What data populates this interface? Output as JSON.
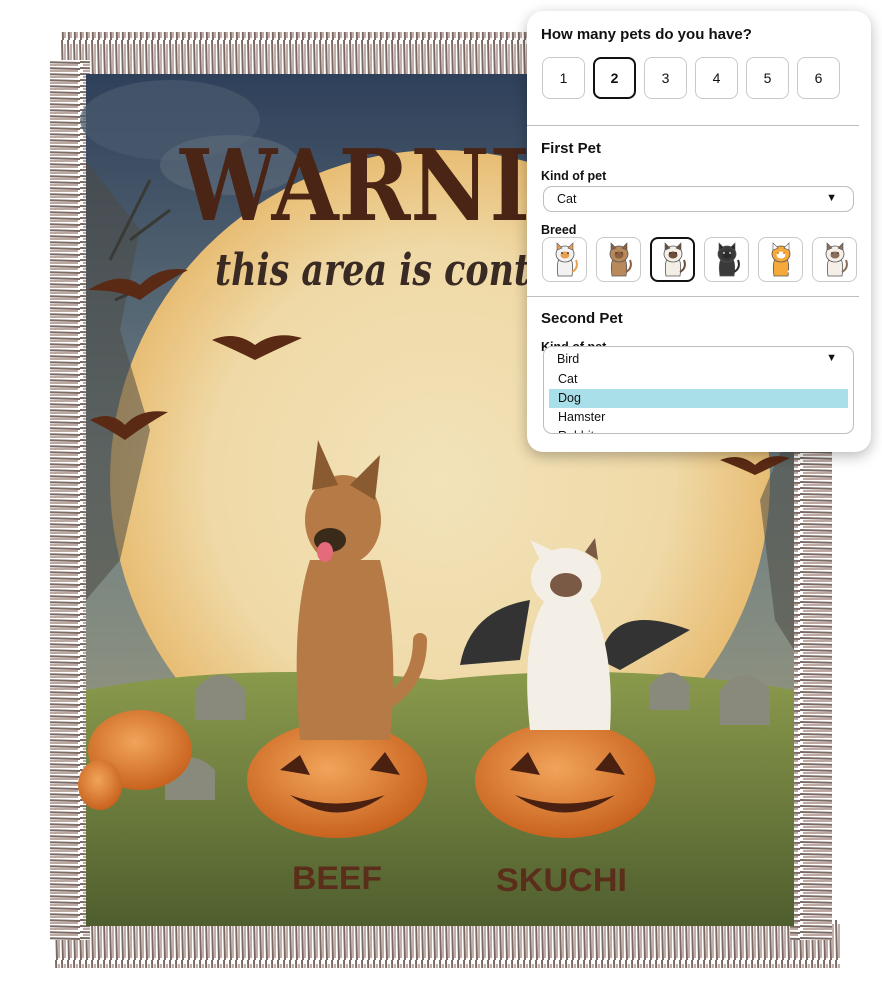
{
  "blanket": {
    "title": "WARNI",
    "subtitle": "this area is cont",
    "pets": [
      {
        "name": "BEEF"
      },
      {
        "name": "SKUCHI"
      }
    ]
  },
  "customizer": {
    "question": "How many pets do you have?",
    "count_options": [
      "1",
      "2",
      "3",
      "4",
      "5",
      "6"
    ],
    "selected_count": "2",
    "first_pet": {
      "section_title": "First Pet",
      "kind_label": "Kind of pet",
      "kind_value": "Cat",
      "breed_label": "Breed",
      "breeds": [
        {
          "icon": "calico-cat-icon",
          "colors": [
            "#f2f2f2",
            "#e8a050",
            "#444444"
          ]
        },
        {
          "icon": "tabby-cat-icon",
          "colors": [
            "#b8895a",
            "#8a6040",
            "#5a3b24"
          ]
        },
        {
          "icon": "siamese-cat-icon",
          "colors": [
            "#f4efe6",
            "#6b4f3a",
            "#3b2b20"
          ]
        },
        {
          "icon": "black-cat-icon",
          "colors": [
            "#3a3a3a",
            "#2a2a2a",
            "#cccccc"
          ]
        },
        {
          "icon": "orange-cat-icon",
          "colors": [
            "#f5a93a",
            "#ffffff",
            "#d87d10"
          ]
        },
        {
          "icon": "ragdoll-cat-icon",
          "colors": [
            "#f5efe8",
            "#8c6e5c",
            "#5a4538"
          ]
        }
      ],
      "selected_breed_index": 2
    },
    "second_pet": {
      "section_title": "Second Pet",
      "kind_label": "Kind of pet",
      "kind_value": "Bird",
      "options": [
        "Cat",
        "Dog",
        "Hamster",
        "Rabbit"
      ],
      "highlighted_option": "Dog"
    }
  }
}
